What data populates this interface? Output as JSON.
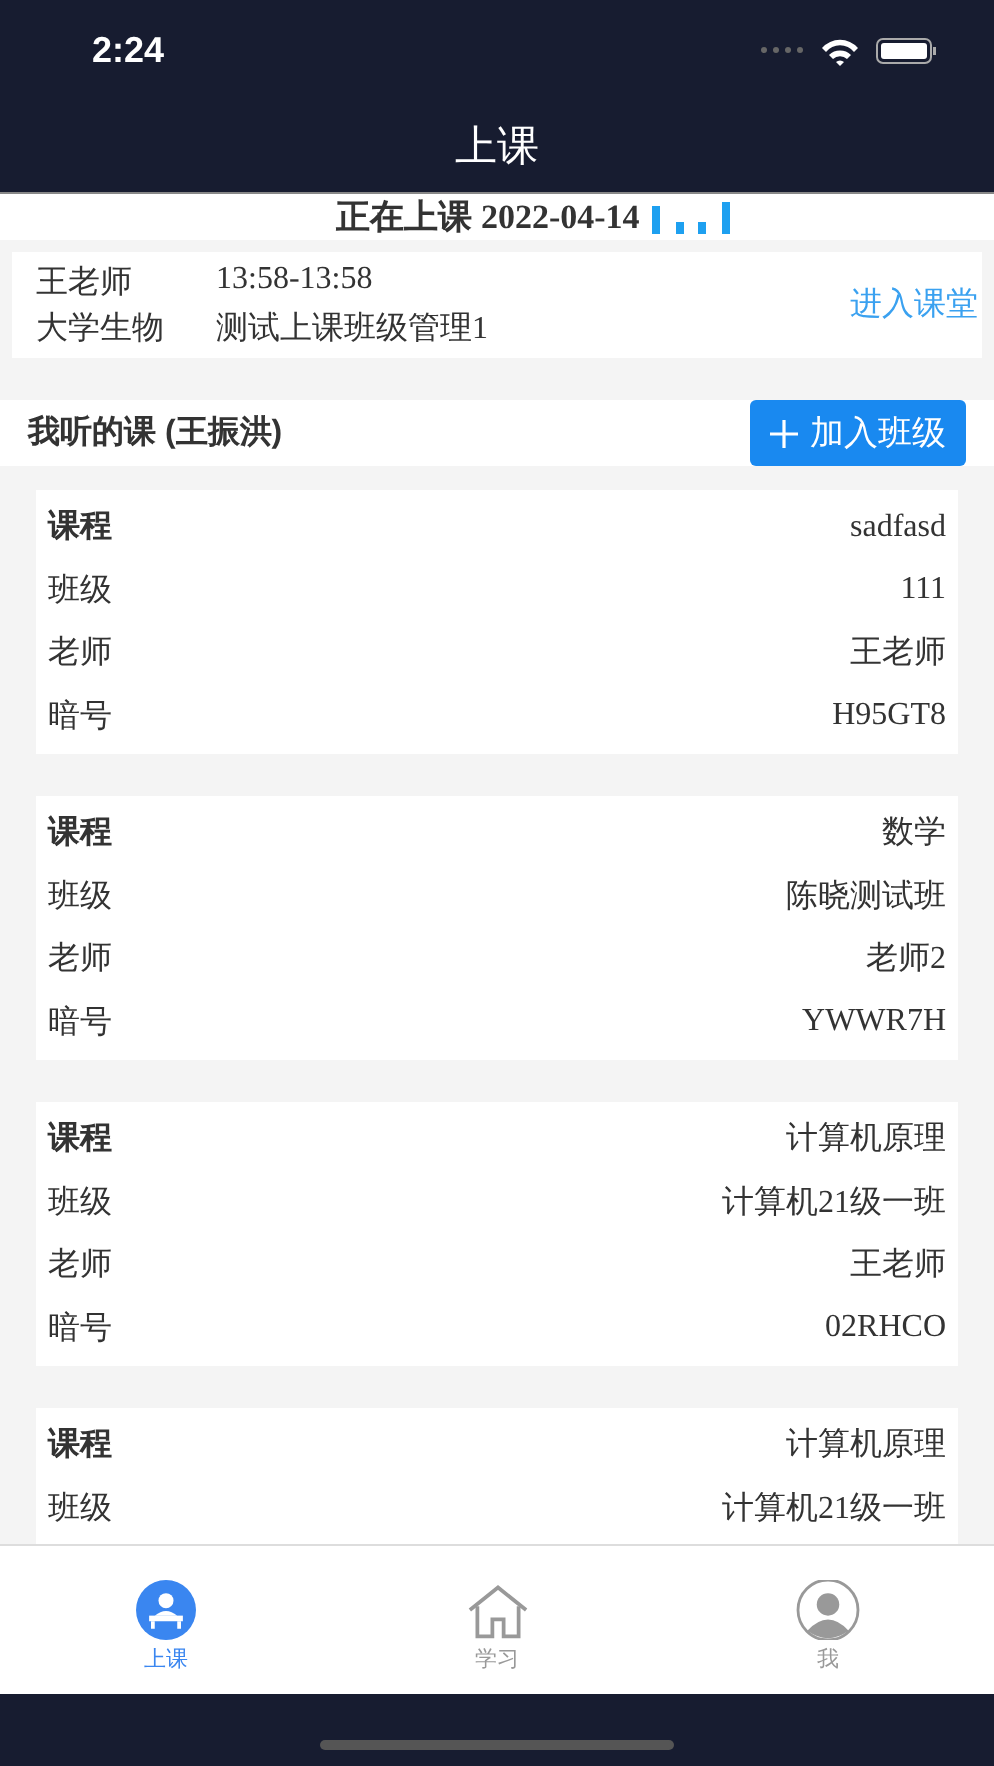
{
  "status_bar": {
    "time": "2:24"
  },
  "header": {
    "title": "上课"
  },
  "live": {
    "label": "正在上课",
    "date": "2022-04-14"
  },
  "current_class": {
    "teacher": "王老师",
    "time": "13:58-13:58",
    "course": "大学生物",
    "class_name": "测试上课班级管理1",
    "action": "进入课堂"
  },
  "my_courses": {
    "title": "我听的课 (王振洪)",
    "button": "加入班级"
  },
  "cards": [
    {
      "rows": [
        {
          "label": "课程",
          "value": "sadfasd"
        },
        {
          "label": "班级",
          "value": "111"
        },
        {
          "label": "老师",
          "value": "王老师"
        },
        {
          "label": "暗号",
          "value": "H95GT8"
        }
      ]
    },
    {
      "rows": [
        {
          "label": "课程",
          "value": "数学"
        },
        {
          "label": "班级",
          "value": "陈晓测试班"
        },
        {
          "label": "老师",
          "value": "老师2"
        },
        {
          "label": "暗号",
          "value": "YWWR7H"
        }
      ]
    },
    {
      "rows": [
        {
          "label": "课程",
          "value": "计算机原理"
        },
        {
          "label": "班级",
          "value": "计算机21级一班"
        },
        {
          "label": "老师",
          "value": "王老师"
        },
        {
          "label": "暗号",
          "value": "02RHCO"
        }
      ]
    },
    {
      "rows": [
        {
          "label": "课程",
          "value": "计算机原理"
        },
        {
          "label": "班级",
          "value": "计算机21级一班"
        }
      ]
    }
  ],
  "tabs": [
    {
      "label": "上课",
      "selected": true
    },
    {
      "label": "学习",
      "selected": false
    },
    {
      "label": "我",
      "selected": false
    }
  ]
}
